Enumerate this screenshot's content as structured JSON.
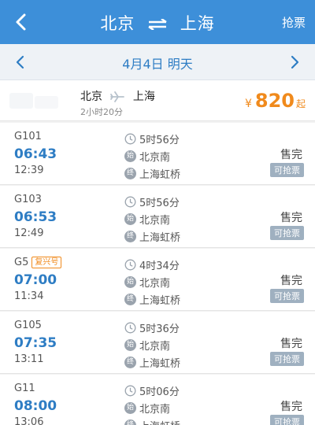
{
  "header": {
    "from": "北京",
    "to": "上海",
    "grab_label": "抢票",
    "bg_color": "#3d8fd9"
  },
  "date_bar": {
    "date": "4月4日 明天"
  },
  "summary": {
    "from": "北京",
    "to": "上海",
    "duration": "2小时20分",
    "currency": "¥",
    "price": "820",
    "suffix": "起",
    "price_color": "#f08a1c"
  },
  "station_icons": {
    "start": "始",
    "end": "终"
  },
  "trains": [
    {
      "no": "G101",
      "badge": "",
      "dep": "06:43",
      "arr": "12:39",
      "duration": "5时56分",
      "from": "北京南",
      "to": "上海虹桥",
      "status": "售完",
      "action": "可抢票"
    },
    {
      "no": "G103",
      "badge": "",
      "dep": "06:53",
      "arr": "12:49",
      "duration": "5时56分",
      "from": "北京南",
      "to": "上海虹桥",
      "status": "售完",
      "action": "可抢票"
    },
    {
      "no": "G5",
      "badge": "复兴号",
      "dep": "07:00",
      "arr": "11:34",
      "duration": "4时34分",
      "from": "北京南",
      "to": "上海虹桥",
      "status": "售完",
      "action": "可抢票"
    },
    {
      "no": "G105",
      "badge": "",
      "dep": "07:35",
      "arr": "13:11",
      "duration": "5时36分",
      "from": "北京南",
      "to": "上海虹桥",
      "status": "售完",
      "action": "可抢票"
    },
    {
      "no": "G11",
      "badge": "",
      "dep": "08:00",
      "arr": "13:06",
      "duration": "5时06分",
      "from": "北京南",
      "to": "上海虹桥",
      "status": "售完",
      "action": "可抢票"
    }
  ]
}
